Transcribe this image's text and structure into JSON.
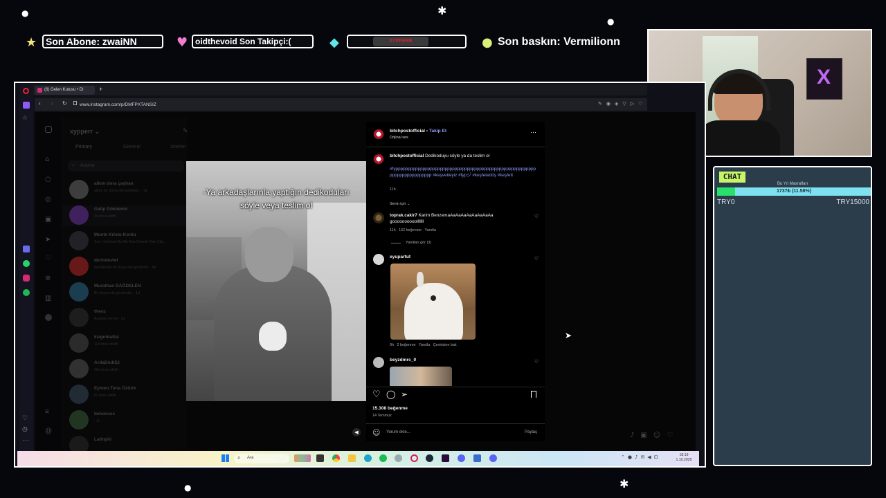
{
  "overlay": {
    "last_sub": "Son Abone: zwaiNN",
    "last_follower": "oidthevoid    Son Takipçi:(",
    "last_raid": "Son baskın: Vermilionn",
    "ticker_logo": "XYPPERR"
  },
  "chat": {
    "label": "CHAT",
    "goal_title": "Bu Yıl Masrafları",
    "goal_text": "1737₺ (11.58%)",
    "goal_fraction": 0.1158,
    "goal_min": "TRY0",
    "goal_max": "TRY15000"
  },
  "browser": {
    "tab_title": "(6) Gelen Kutusu • Di",
    "url": "www.instagram.com/p/DMFPXTANSIZ"
  },
  "dm": {
    "username": "xypperr",
    "tabs": [
      "Primary",
      "General",
      "İstekler"
    ],
    "search_placeholder": "Arama",
    "threads": [
      {
        "name": "alkım dora çayhan",
        "sub": "alkım bir dosya eki gönderdi. · 1d"
      },
      {
        "name": "Galip Gökdemir",
        "sub": "4d önce aktifti"
      },
      {
        "name": "Monte Kristo Kontu",
        "sub": "Sen: Herkesin Bu Altı Ana Önemli Olan Clip..."
      },
      {
        "name": "derindevlet",
        "sub": "derindevlet bir dosya eki gönderdi. · 6d"
      },
      {
        "name": "Murathan DAĞDELEN",
        "sub": "Bir dosya eki gönderdin. · 1d"
      },
      {
        "name": "theuz",
        "sub": "Aaaaaa nereal · 1g"
      },
      {
        "name": "kızgınbattal",
        "sub": "11d önce aktifti"
      },
      {
        "name": "ArdaDndt52",
        "sub": "46d önce aktifti"
      },
      {
        "name": "Eymen Tuna Öztürk",
        "sub": "5s önce aktifti"
      },
      {
        "name": "lemonsss",
        "sub": "· 1h"
      },
      {
        "name": "Lalinphi",
        "sub": ""
      }
    ]
  },
  "post": {
    "author": "bitchpostofficial",
    "follow": "Takip Et",
    "audio": "Orijinal ses",
    "video_caption": "-Ya arkadaşlarınla yaptığın dedikoduları söyle veya teslim ol",
    "caption_author": "bitchpostofficial",
    "caption_text": "Dedikoduyu söyle ya da teslim ol",
    "hashtags": "#fypppppppppppppppppppppppppppppppppppppppppppppppppppppppppppppppppppppppppp #keşvetteyiz #fypシ゚ #keşfetedüş #keşfett",
    "caption_time": "11h",
    "sort_label": "Senin için",
    "comments": [
      {
        "user": "toprak.cakir7",
        "text": "Karim BenzemaAaAaAaAaAaAaAaAa goooooooooolllllll",
        "meta": "11h   162 beğenme   Yanıtla",
        "replies": "Yanıtları gör (3)"
      },
      {
        "user": "eyupartut",
        "text": "",
        "meta": "9h   2 beğenme   Yanıtla   Çevirisine bak"
      },
      {
        "user": "beyzdmrc_0",
        "text": "",
        "meta": ""
      }
    ],
    "likes": "15.308 beğenme",
    "date": "14 Temmuz",
    "comment_placeholder": "Yorum ekle...",
    "share_label": "Paylaş"
  },
  "taskbar": {
    "search_placeholder": "Ara",
    "time": "18:19",
    "date": "1.10.2025"
  },
  "colors": {
    "link_blue": "#8e9cf5",
    "chat_bg": "#2b3c4b",
    "goal_green": "#28e06a",
    "goal_track": "#7fe0f0",
    "chat_label_bg": "#c6f568"
  }
}
